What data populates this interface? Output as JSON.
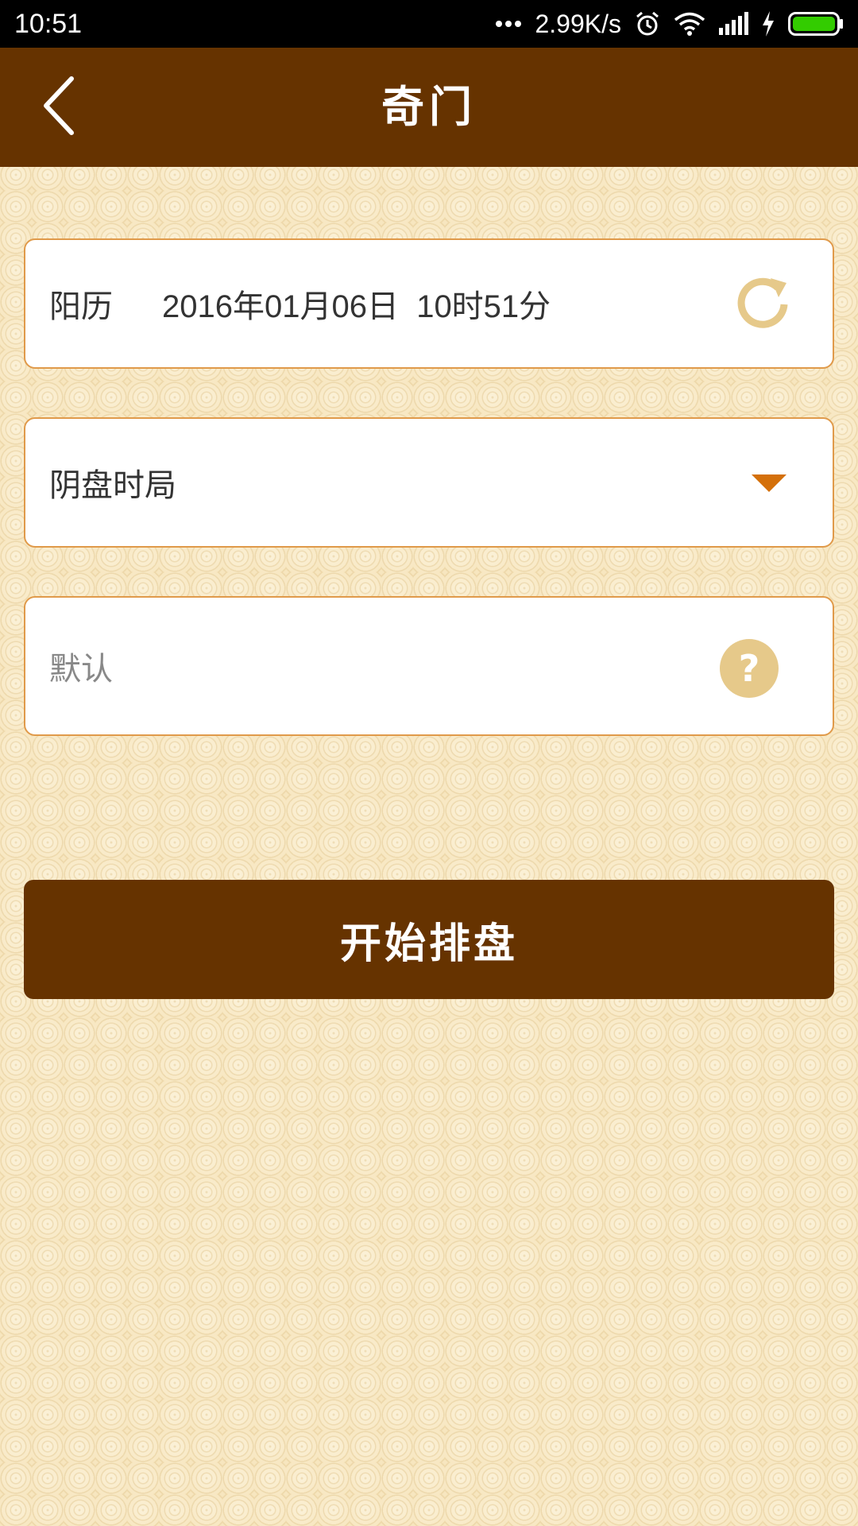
{
  "status_bar": {
    "time": "10:51",
    "network_speed": "2.99K/s",
    "icons": [
      "more-dots-icon",
      "alarm-icon",
      "wifi-icon",
      "signal-icon",
      "charging-icon",
      "battery-icon"
    ]
  },
  "header": {
    "title": "奇门",
    "back_icon": "chevron-left-icon"
  },
  "date_card": {
    "label": "阳历",
    "value": "2016年01月06日  10时51分",
    "refresh_icon": "refresh-icon"
  },
  "type_card": {
    "selected": "阴盘时局",
    "dropdown_icon": "triangle-down-icon"
  },
  "option_card": {
    "placeholder": "默认",
    "help_symbol": "?"
  },
  "actions": {
    "start_label": "开始排盘"
  },
  "colors": {
    "brand": "#663300",
    "accent": "#d4700a",
    "border": "#e09a4a",
    "background": "#f7e6bf",
    "icon_gold": "#e6c98a"
  }
}
